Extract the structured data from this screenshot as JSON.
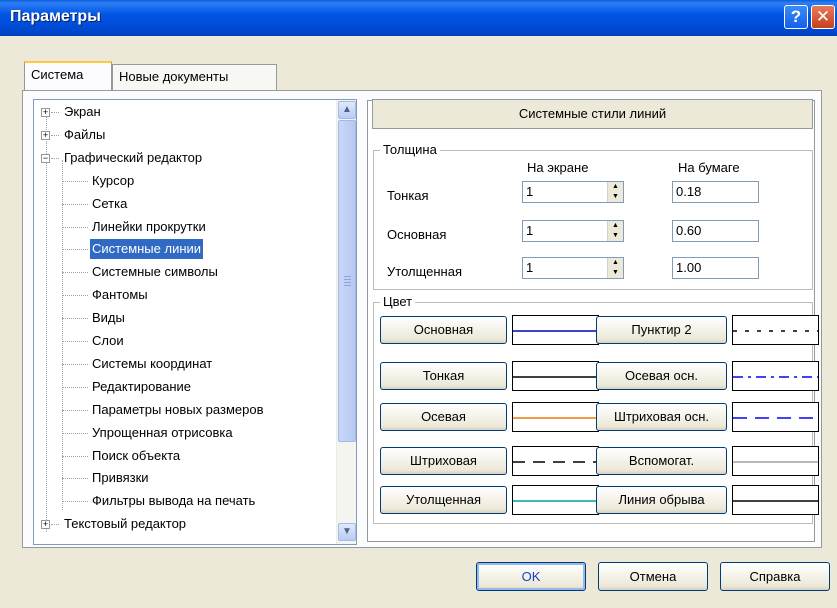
{
  "window": {
    "title": "Параметры",
    "help_glyph": "?",
    "close_glyph": "✕"
  },
  "tabs": [
    {
      "label": "Система",
      "active": true
    },
    {
      "label": "Новые документы",
      "active": false
    }
  ],
  "tree": {
    "items": [
      {
        "label": "Экран",
        "expander": "+"
      },
      {
        "label": "Файлы",
        "expander": "+"
      },
      {
        "label": "Графический редактор",
        "expander": "−"
      },
      {
        "label": "Курсор"
      },
      {
        "label": "Сетка"
      },
      {
        "label": "Линейки прокрутки"
      },
      {
        "label": "Системные линии",
        "selected": true
      },
      {
        "label": "Системные символы"
      },
      {
        "label": "Фантомы"
      },
      {
        "label": "Виды"
      },
      {
        "label": "Слои"
      },
      {
        "label": "Системы координат"
      },
      {
        "label": "Редактирование"
      },
      {
        "label": "Параметры новых размеров"
      },
      {
        "label": "Упрощенная отрисовка"
      },
      {
        "label": "Поиск объекта"
      },
      {
        "label": "Привязки"
      },
      {
        "label": "Фильтры вывода на печать"
      },
      {
        "label": "Текстовый редактор",
        "expander": "+"
      }
    ],
    "scroll_up": "▲",
    "scroll_down": "▼"
  },
  "panel": {
    "header": "Системные стили линий",
    "thickness": {
      "group_label": "Толщина",
      "col_screen": "На экране",
      "col_paper": "На бумаге",
      "rows": [
        {
          "label": "Тонкая",
          "screen": "1",
          "paper": "0.18"
        },
        {
          "label": "Основная",
          "screen": "1",
          "paper": "0.60"
        },
        {
          "label": "Утолщенная",
          "screen": "1",
          "paper": "1.00"
        }
      ]
    },
    "color": {
      "group_label": "Цвет",
      "left": [
        {
          "label": "Основная",
          "color": "#0000c0",
          "style": "solid"
        },
        {
          "label": "Тонкая",
          "color": "#000000",
          "style": "solid"
        },
        {
          "label": "Осевая",
          "color": "#f07800",
          "style": "solid"
        },
        {
          "label": "Штриховая",
          "color": "#000000",
          "style": "dash"
        },
        {
          "label": "Утолщенная",
          "color": "#00a0a0",
          "style": "solid"
        }
      ],
      "right": [
        {
          "label": "Пунктир 2",
          "color": "#000000",
          "style": "dotted"
        },
        {
          "label": "Осевая осн.",
          "color": "#0000ff",
          "style": "dashdot"
        },
        {
          "label": "Штриховая осн.",
          "color": "#0000ff",
          "style": "longdash"
        },
        {
          "label": "Вспомогат.",
          "color": "#a0a0a0",
          "style": "solid"
        },
        {
          "label": "Линия обрыва",
          "color": "#000000",
          "style": "solid"
        }
      ]
    }
  },
  "buttons": {
    "ok": "OK",
    "cancel": "Отмена",
    "help": "Справка"
  }
}
